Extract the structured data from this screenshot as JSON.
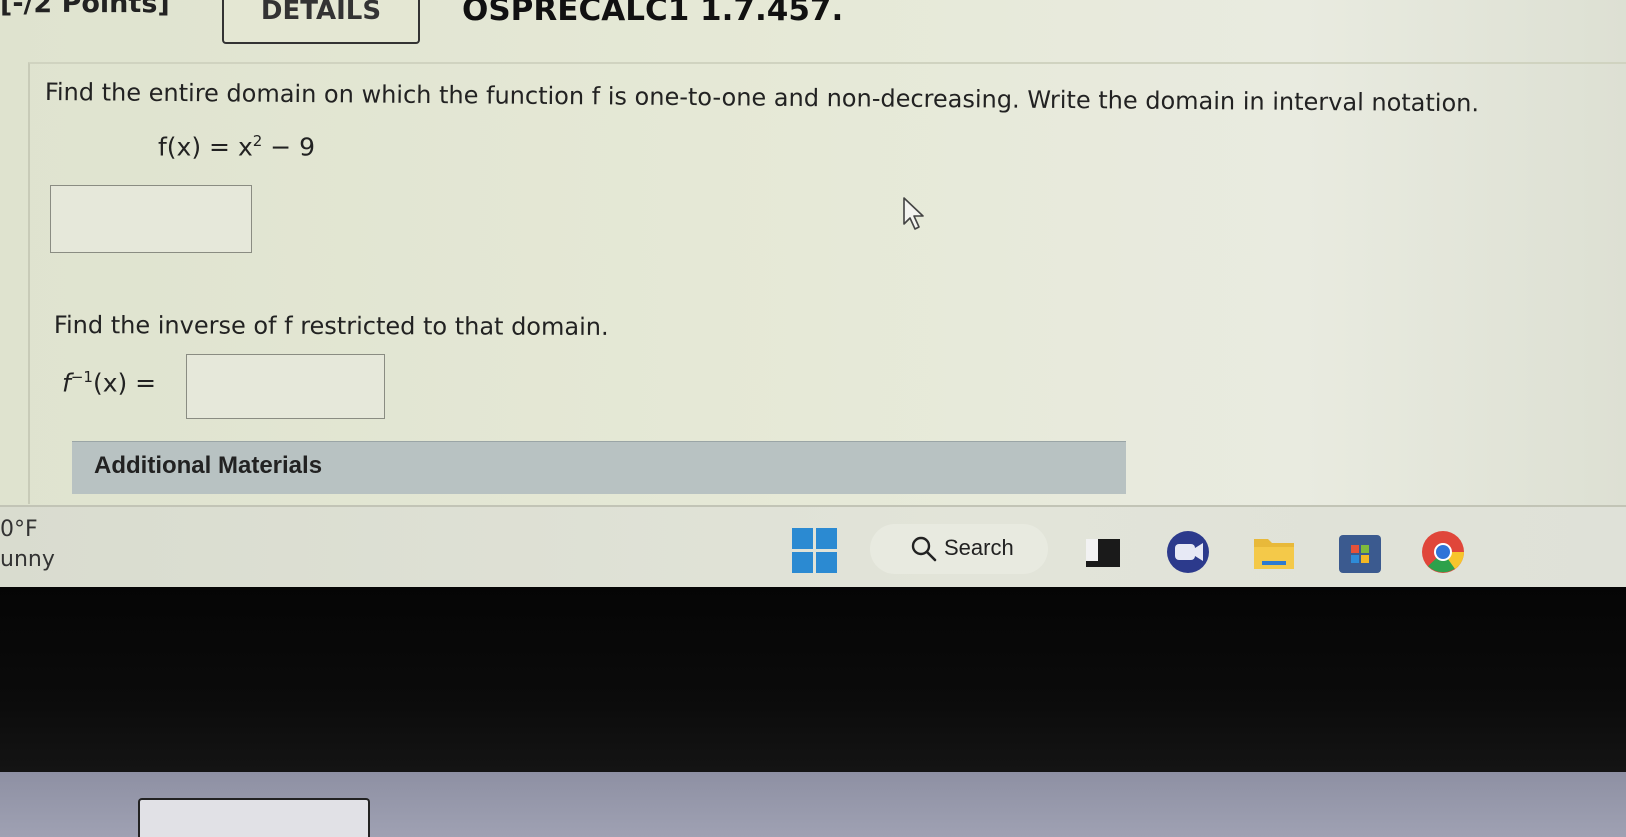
{
  "header": {
    "points_label": "[-/2 Points]",
    "details_button": "DETAILS",
    "problem_id": "OSPRECALC1 1.7.457."
  },
  "question": {
    "prompt_1": "Find the entire domain on which the function f is one-to-one and non-decreasing. Write the domain in interval notation.",
    "function_lhs": "f(x) = x",
    "function_exponent": "2",
    "function_rhs": " − 9",
    "answer_1_value": "",
    "prompt_2": "Find the inverse of f restricted to that domain.",
    "inverse_lhs_f": "f",
    "inverse_exponent": "−1",
    "inverse_rhs": "(x) =",
    "answer_2_value": "",
    "additional_materials": "Additional Materials"
  },
  "taskbar": {
    "weather_temp": "0°F",
    "weather_desc": "unny",
    "search_label": "Search",
    "apps": [
      {
        "name": "file-explorer-dark-icon"
      },
      {
        "name": "meet-now-icon"
      },
      {
        "name": "file-explorer-icon"
      },
      {
        "name": "microsoft-store-icon"
      },
      {
        "name": "chrome-icon"
      }
    ]
  },
  "colors": {
    "screen_bg": "#e6e9d7",
    "materials_bar": "#b8c2c2",
    "accent_blue": "#2b8ad2"
  }
}
